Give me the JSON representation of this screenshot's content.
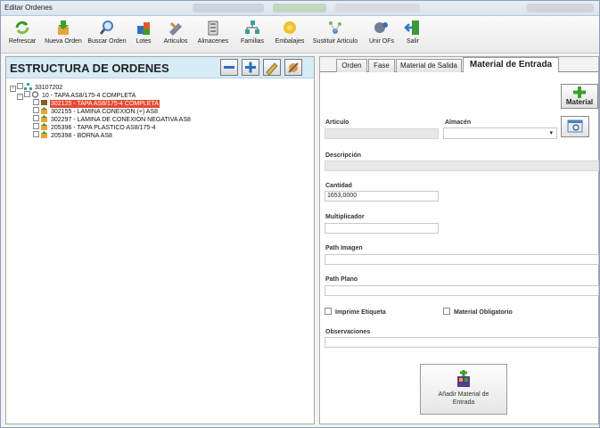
{
  "window": {
    "title": "Editar Ordenes"
  },
  "toolbar": {
    "buttons": [
      {
        "label": "Refrescar",
        "icon": "refresh-icon"
      },
      {
        "label": "Nueva Orden",
        "icon": "new-order-icon"
      },
      {
        "label": "Buscar Orden",
        "icon": "search-icon"
      },
      {
        "label": "Lotes",
        "icon": "lots-icon"
      },
      {
        "label": "Articulos",
        "icon": "articles-icon"
      },
      {
        "label": "Almacenes",
        "icon": "warehouse-icon"
      },
      {
        "label": "Familias",
        "icon": "families-icon"
      },
      {
        "label": "Embalajes",
        "icon": "packaging-icon"
      },
      {
        "label": "Sustituir Articulo",
        "icon": "replace-article-icon"
      },
      {
        "label": "Unir OFs",
        "icon": "merge-icon"
      },
      {
        "label": "Salir",
        "icon": "exit-icon"
      }
    ]
  },
  "left": {
    "header": "ESTRUCTURA DE ORDENES",
    "tree": {
      "root": "33107202",
      "order": "10 - TAPA  AS8/175-4 COMPLETA",
      "selected": "302125 - TAPA  AS8/175-4 COMPLETA",
      "children": [
        "302155 - LAMINA CONEXION (+) AS8",
        "302297 - LAMINA DE CONEXION NEGATIVA AS8",
        "205396 - TAPA PLASTICO AS8/175-4",
        "205398 - BORNA AS8"
      ]
    }
  },
  "tabs": [
    "Orden",
    "Fase",
    "Material de Salida",
    "Material de Entrada"
  ],
  "form": {
    "articulo_label": "Articulo",
    "almacen_label": "Almacén",
    "descripcion_label": "Descripción",
    "cantidad_label": "Cantidad",
    "cantidad_value": "1653,0000",
    "multiplicador_label": "Multiplicador",
    "path_imagen_label": "Path Imagen",
    "path_plano_label": "Path Plano",
    "imprime_label": "Imprime Etiqueta",
    "obligatorio_label": "Material Obligatorio",
    "observaciones_label": "Observaciones",
    "add_button": "Añadir Material de Entrada",
    "material_button": "Material"
  },
  "colors": {
    "selection": "#e34b33",
    "header_bg": "#d6ecf7"
  }
}
